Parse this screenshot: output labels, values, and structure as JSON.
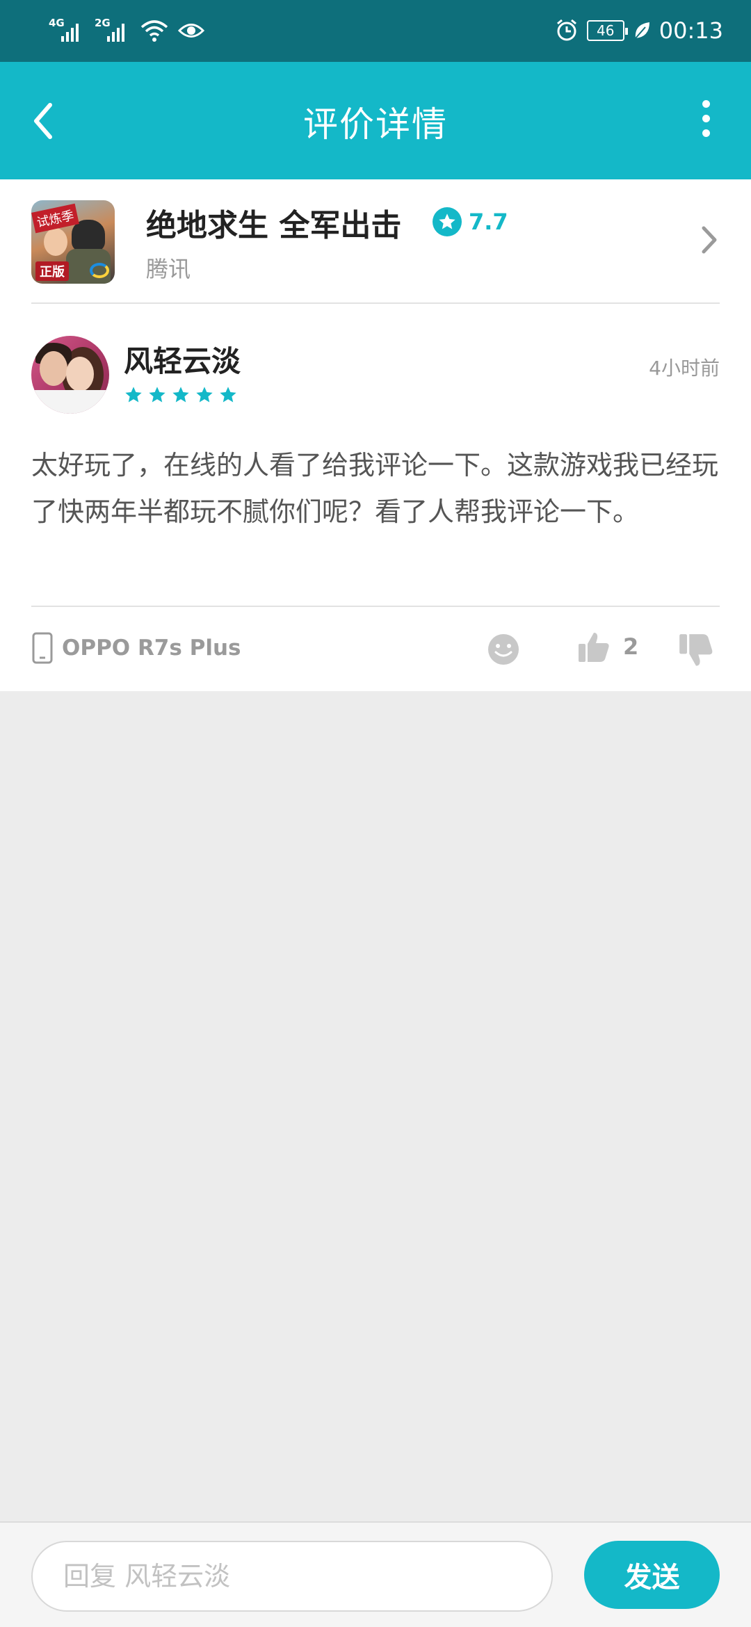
{
  "status_bar": {
    "sim1_net": "4G",
    "sim2_net": "2G",
    "battery": "46",
    "time": "00:13"
  },
  "header": {
    "title": "评价详情",
    "back_icon": "chevron-left-icon",
    "more_icon": "more-vertical-icon"
  },
  "app": {
    "name": "绝地求生 全军出击",
    "rating": "7.7",
    "developer": "腾讯",
    "icon_badge_top": "试炼季",
    "icon_badge_bottom": "正版"
  },
  "review": {
    "user_name": "风轻云淡",
    "stars": 5,
    "time": "4小时前",
    "text": "太好玩了，在线的人看了给我评论一下。这款游戏我已经玩了快两年半都玩不腻你们呢？看了人帮我评论一下。",
    "device": "OPPO R7s Plus",
    "like_count": "2"
  },
  "reply": {
    "placeholder": "回复 风轻云淡",
    "send_label": "发送"
  },
  "colors": {
    "status_bar": "#0e6f7b",
    "accent": "#14b8c8",
    "background": "#ececec"
  }
}
